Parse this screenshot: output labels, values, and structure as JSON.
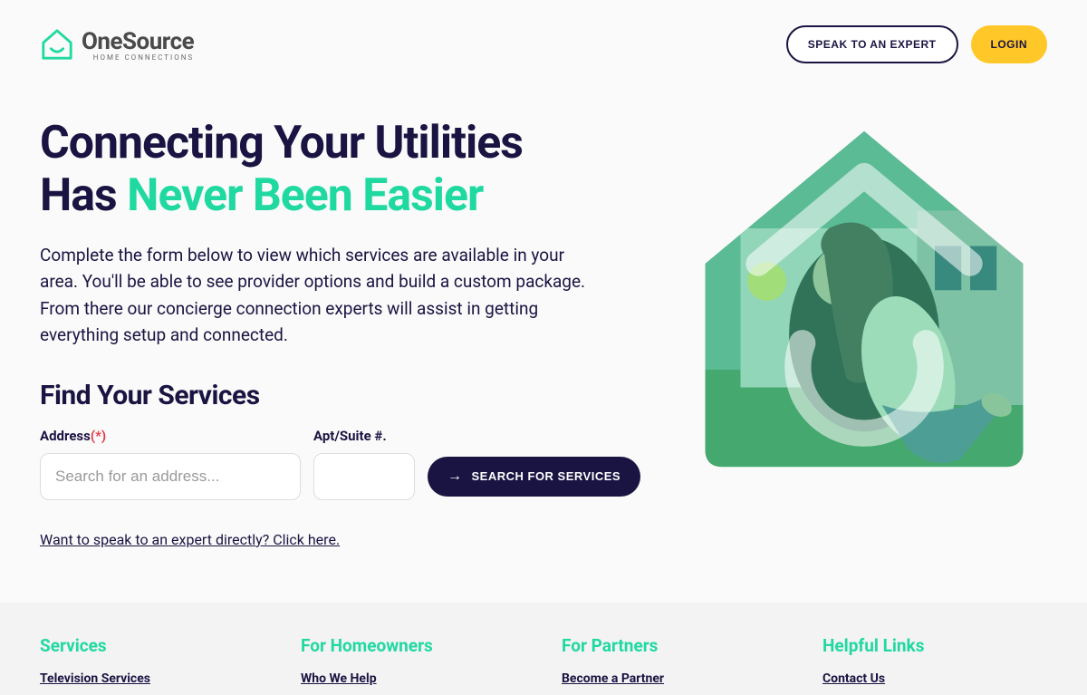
{
  "header": {
    "logo_main": "OneSource",
    "logo_sub": "HOME CONNECTIONS",
    "expert_button": "SPEAK TO AN EXPERT",
    "login_button": "LOGIN"
  },
  "hero": {
    "title_line1": "Connecting Your Utilities",
    "title_line2_prefix": "Has ",
    "title_line2_accent": "Never Been Easier",
    "description": "Complete the form below to view which services are available in your area. You'll be able to see provider options and build a custom package. From there our concierge connection experts will assist in getting everything setup and connected.",
    "find_heading": "Find Your Services",
    "address_label": "Address",
    "required_marker": "(*)",
    "address_placeholder": "Search for an address...",
    "apt_label": "Apt/Suite #.",
    "search_button": "SEARCH FOR SERVICES",
    "expert_link": "Want to speak to an expert directly? Click here."
  },
  "footer": {
    "cols": [
      {
        "heading": "Services",
        "link": "Television Services"
      },
      {
        "heading": "For Homeowners",
        "link": "Who We Help"
      },
      {
        "heading": "For Partners",
        "link": "Become a Partner"
      },
      {
        "heading": "Helpful Links",
        "link": "Contact Us"
      }
    ]
  }
}
